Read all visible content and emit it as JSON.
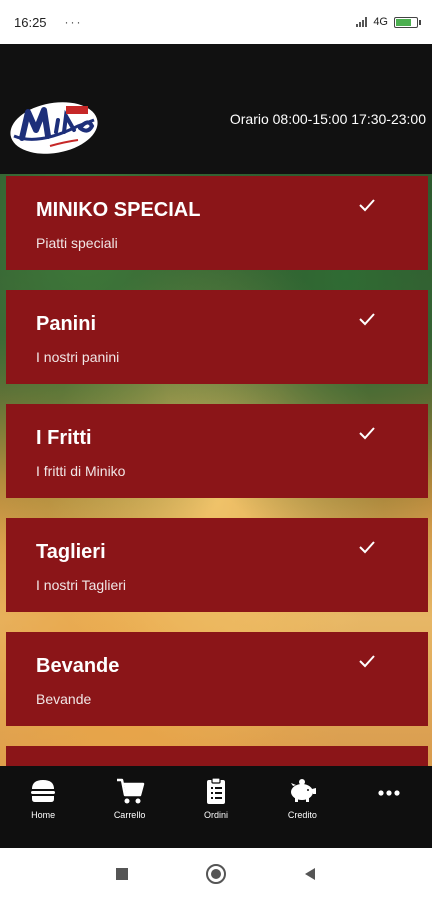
{
  "status": {
    "time": "16:25",
    "dots": "···",
    "network": "4G"
  },
  "header": {
    "hours": "Orario 08:00-15:00 17:30-23:00"
  },
  "categories": [
    {
      "title": "MINIKO SPECIAL",
      "subtitle": "Piatti speciali"
    },
    {
      "title": "Panini",
      "subtitle": "I nostri panini"
    },
    {
      "title": "I Fritti",
      "subtitle": "I fritti di Miniko"
    },
    {
      "title": "Taglieri",
      "subtitle": "I nostri Taglieri"
    },
    {
      "title": "Bevande",
      "subtitle": "Bevande"
    }
  ],
  "nav": {
    "home": "Home",
    "cart": "Carrello",
    "orders": "Ordini",
    "credit": "Credito"
  },
  "colors": {
    "card": "#8b1518",
    "header": "#111111"
  }
}
